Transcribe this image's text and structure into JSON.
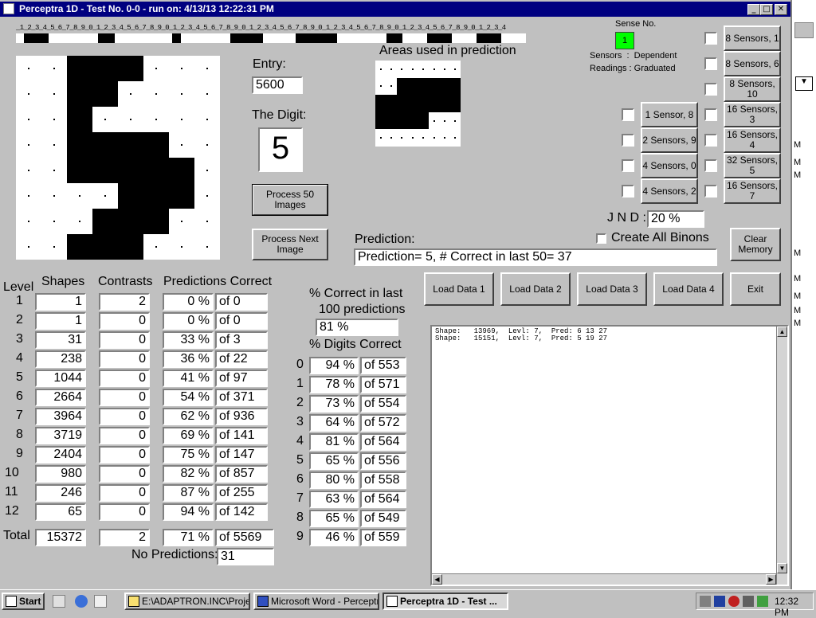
{
  "window": {
    "title": "Perceptra 1D - Test No. 0-0 - run on: 4/13/13  12:22:31 PM",
    "min_glyph": "_",
    "max_glyph": "□",
    "close_glyph": "✕"
  },
  "ruler": {
    "text": "_1_2_3_4_5_6_7_8_9_0_1_2_3_4_5_6_7_8_9_0_1_2_3_4_5_6_7_8_9_0_1_2_3_4_5_6_7_8_9_0_1_2_3_4_5_6_7_8_9_0_1_2_3_4_5_6_7_8_9_0_1_2_3_4",
    "cells": [
      0,
      1,
      1,
      1,
      0,
      0,
      0,
      0,
      0,
      0,
      1,
      1,
      0,
      0,
      0,
      0,
      0,
      0,
      0,
      1,
      0,
      0,
      0,
      0,
      0,
      0,
      1,
      1,
      1,
      1,
      0,
      0,
      0,
      0,
      1,
      1,
      1,
      1,
      1,
      0,
      0,
      0,
      0,
      0,
      0,
      1,
      1,
      0,
      0,
      0,
      1,
      1,
      1,
      0,
      0,
      0,
      1,
      1,
      1,
      0,
      0,
      0
    ]
  },
  "digit_image": {
    "cols": 8,
    "rows": 8,
    "cells": [
      [
        0,
        0,
        1,
        1,
        1,
        0,
        0,
        0
      ],
      [
        0,
        0,
        1,
        1,
        0,
        0,
        0,
        0
      ],
      [
        0,
        0,
        1,
        0,
        0,
        0,
        0,
        0
      ],
      [
        0,
        0,
        1,
        1,
        1,
        1,
        0,
        0
      ],
      [
        0,
        0,
        1,
        1,
        1,
        1,
        1,
        0
      ],
      [
        0,
        0,
        0,
        0,
        1,
        1,
        1,
        0
      ],
      [
        0,
        0,
        0,
        1,
        1,
        1,
        0,
        0
      ],
      [
        0,
        0,
        1,
        1,
        1,
        0,
        0,
        0
      ]
    ]
  },
  "areas_image": {
    "cols": 8,
    "rows": 5,
    "cells": [
      [
        0,
        0,
        0,
        0,
        0,
        0,
        0,
        0
      ],
      [
        0,
        0,
        1,
        1,
        1,
        1,
        1,
        1
      ],
      [
        1,
        1,
        1,
        1,
        1,
        1,
        1,
        1
      ],
      [
        1,
        1,
        1,
        1,
        1,
        0,
        0,
        0
      ],
      [
        0,
        0,
        0,
        0,
        0,
        0,
        0,
        0
      ]
    ]
  },
  "labels": {
    "entry": "Entry:",
    "the_digit": "The Digit:",
    "areas_used": "Areas used in prediction",
    "sense_no": "Sense No.",
    "sensors_line": "Sensors  :  Dependent",
    "readings_line": "Readings : Graduated",
    "jnd": "J N D :",
    "prediction": "Prediction:",
    "create_all": "Create All Binons",
    "level": "Level",
    "shapes": "Shapes",
    "contrasts": "Contrasts",
    "predictions_correct": "Predictions Correct",
    "pct_last_1": "% Correct in last",
    "pct_last_2": "100 predictions",
    "pct_digits": "% Digits Correct",
    "total": "Total",
    "no_predictions": "No Predictions:"
  },
  "values": {
    "entry": "5600",
    "digit": "5",
    "sense_no": "1",
    "jnd": "20 %",
    "prediction": "Prediction= 5, # Correct in last 50= 37",
    "pct_last_100": "81 %",
    "no_predictions": "31"
  },
  "buttons": {
    "process_50": "Process 50 Images",
    "process_next": "Process Next Image",
    "clear_memory": "Clear Memory",
    "load1": "Load Data 1",
    "load2": "Load Data 2",
    "load3": "Load Data 3",
    "load4": "Load Data 4",
    "exit": "Exit"
  },
  "sensors_right": [
    "8 Sensors, 1",
    "8 Sensors, 6",
    "8 Sensors, 10",
    "16 Sensors, 3",
    "16 Sensors, 4",
    "32 Sensors, 5",
    "16 Sensors, 7"
  ],
  "sensors_left": [
    "1 Sensor, 8",
    "2 Sensors, 9",
    "4 Sensors, 0",
    "4 Sensors, 2"
  ],
  "levels": [
    {
      "level": "1",
      "shapes": "1",
      "contrasts": "2",
      "pct": "0 %",
      "of": "of 0"
    },
    {
      "level": "2",
      "shapes": "1",
      "contrasts": "0",
      "pct": "0 %",
      "of": "of 0"
    },
    {
      "level": "3",
      "shapes": "31",
      "contrasts": "0",
      "pct": "33 %",
      "of": "of 3"
    },
    {
      "level": "4",
      "shapes": "238",
      "contrasts": "0",
      "pct": "36 %",
      "of": "of 22"
    },
    {
      "level": "5",
      "shapes": "1044",
      "contrasts": "0",
      "pct": "41 %",
      "of": "of 97"
    },
    {
      "level": "6",
      "shapes": "2664",
      "contrasts": "0",
      "pct": "54 %",
      "of": "of 371"
    },
    {
      "level": "7",
      "shapes": "3964",
      "contrasts": "0",
      "pct": "62 %",
      "of": "of 936"
    },
    {
      "level": "8",
      "shapes": "3719",
      "contrasts": "0",
      "pct": "69 %",
      "of": "of 141"
    },
    {
      "level": "9",
      "shapes": "2404",
      "contrasts": "0",
      "pct": "75 %",
      "of": "of 147"
    },
    {
      "level": "10",
      "shapes": "980",
      "contrasts": "0",
      "pct": "82 %",
      "of": "of 857"
    },
    {
      "level": "11",
      "shapes": "246",
      "contrasts": "0",
      "pct": "87 %",
      "of": "of 255"
    },
    {
      "level": "12",
      "shapes": "65",
      "contrasts": "0",
      "pct": "94 %",
      "of": "of 142"
    }
  ],
  "totals": {
    "shapes": "15372",
    "contrasts": "2",
    "pct": "71 %",
    "of": "of 5569"
  },
  "digits": [
    {
      "digit": "0",
      "pct": "94 %",
      "of": "of 553"
    },
    {
      "digit": "1",
      "pct": "78 %",
      "of": "of 571"
    },
    {
      "digit": "2",
      "pct": "73 %",
      "of": "of 554"
    },
    {
      "digit": "3",
      "pct": "64 %",
      "of": "of 572"
    },
    {
      "digit": "4",
      "pct": "81 %",
      "of": "of 564"
    },
    {
      "digit": "5",
      "pct": "65 %",
      "of": "of 556"
    },
    {
      "digit": "6",
      "pct": "80 %",
      "of": "of 558"
    },
    {
      "digit": "7",
      "pct": "63 %",
      "of": "of 564"
    },
    {
      "digit": "8",
      "pct": "65 %",
      "of": "of 549"
    },
    {
      "digit": "9",
      "pct": "46 %",
      "of": "of 559"
    }
  ],
  "output_lines": "Shape:   13969,  Levl: 7,  Pred: 6 13 27\nShape:   15151,  Levl: 7,  Pred: 5 19 27",
  "colors": {
    "title_bar": "#000080",
    "sense_indicator": "#00ff00",
    "face": "#c0c0c0"
  },
  "taskbar": {
    "start": "Start",
    "tasks": [
      "E:\\ADAPTRON.INC\\Proje...",
      "Microsoft Word - Perceptra...",
      "Perceptra 1D - Test ..."
    ],
    "clock": "12:32 PM"
  },
  "bg_window_letters": [
    "M",
    "M",
    "M",
    "M",
    "M",
    "M",
    "M",
    "M"
  ]
}
